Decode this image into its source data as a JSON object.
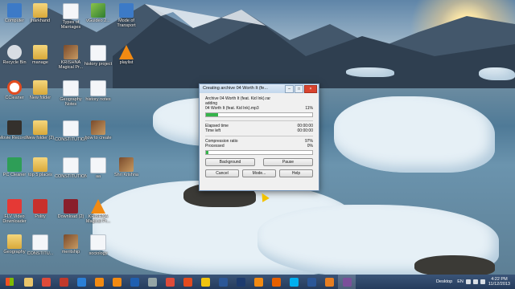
{
  "desktop": {
    "icons": [
      {
        "label": "Computer",
        "glyph": "computer-icon",
        "cls": "g-exe"
      },
      {
        "label": "jharkhand",
        "glyph": "folder-icon",
        "cls": "g-folder"
      },
      {
        "label": "Types of Marriages",
        "glyph": "document-icon",
        "cls": "g-doc"
      },
      {
        "label": "vGuideo 2...",
        "glyph": "video-icon",
        "cls": "g-arrow"
      },
      {
        "label": "Mode of Transport",
        "glyph": "presentation-icon",
        "cls": "g-exe"
      },
      {
        "label": "Recycle Bin",
        "glyph": "recycle-bin-icon",
        "cls": "g-gear"
      },
      {
        "label": "manage",
        "glyph": "folder-icon",
        "cls": "g-folder"
      },
      {
        "label": "KRISHNA Magical Pr...",
        "glyph": "image-icon",
        "cls": "g-img"
      },
      {
        "label": "history project",
        "glyph": "document-icon",
        "cls": "g-doc"
      },
      {
        "label": "playlist",
        "glyph": "vlc-icon",
        "cls": "g-vlc"
      },
      {
        "label": "CCleaner",
        "glyph": "ccleaner-icon",
        "cls": "g-cc"
      },
      {
        "label": "New folder",
        "glyph": "folder-icon",
        "cls": "g-folder"
      },
      {
        "label": "Geography Notes",
        "glyph": "document-icon",
        "cls": "g-doc"
      },
      {
        "label": "history notes",
        "glyph": "document-icon",
        "cls": "g-doc"
      },
      {
        "label": "Movie Recorder",
        "glyph": "movie-icon",
        "cls": "g-dark"
      },
      {
        "label": "New folder (2)",
        "glyph": "folder-icon",
        "cls": "g-folder"
      },
      {
        "label": "CONSTITUTION",
        "glyph": "document-icon",
        "cls": "g-doc"
      },
      {
        "label": "how to create",
        "glyph": "image-icon",
        "cls": "g-img"
      },
      {
        "label": "PC Cleaner",
        "glyph": "pc-cleaner-icon",
        "cls": "g-green"
      },
      {
        "label": "top 5 places",
        "glyph": "folder-icon",
        "cls": "g-folder"
      },
      {
        "label": "CONSTITUTION",
        "glyph": "document-icon",
        "cls": "g-doc"
      },
      {
        "label": "aa",
        "glyph": "document-icon",
        "cls": "g-doc"
      },
      {
        "label": "Shri Krishna",
        "glyph": "image-icon",
        "cls": "g-img"
      },
      {
        "label": "FLV Video Downloader",
        "glyph": "downloader-icon",
        "cls": "g-red"
      },
      {
        "label": "Polity",
        "glyph": "pdf-icon",
        "cls": "g-pdf"
      },
      {
        "label": "Download (2)",
        "glyph": "archive-icon",
        "cls": "g-maroon"
      },
      {
        "label": "KRISHNA Magical Pr...",
        "glyph": "vlc-icon",
        "cls": "g-vlc"
      },
      {
        "label": "Geography",
        "glyph": "folder-icon",
        "cls": "g-folder"
      },
      {
        "label": "CONSTITU...",
        "glyph": "document-icon",
        "cls": "g-doc"
      },
      {
        "label": "meritship",
        "glyph": "image-icon",
        "cls": "g-img"
      },
      {
        "label": "sociology",
        "glyph": "document-icon",
        "cls": "g-doc"
      }
    ]
  },
  "dialog": {
    "title": "Creating archive 04 Worth It (fe...",
    "archive_line": "Archive 04 Worth It (feat. Kid Ink).rar",
    "action": "adding",
    "file": "04 Worth It (feat. Kid Ink).mp3",
    "file_progress_text": "11%",
    "file_progress": 0.11,
    "elapsed_label": "Elapsed time",
    "elapsed_value": "00:00:00",
    "left_label": "Time left",
    "left_value": "00:00:00",
    "ratio_label": "Compression ratio",
    "ratio_value": "97%",
    "processed_label": "Processed",
    "processed_value": "0%",
    "overall_progress": 0.02,
    "buttons": {
      "background": "Background",
      "pause": "Pause",
      "cancel": "Cancel",
      "mode": "Mode...",
      "help": "Help"
    }
  },
  "taskbar": {
    "apps": [
      {
        "name": "explorer-icon",
        "color": "#e9c46a"
      },
      {
        "name": "chrome-icon",
        "color": "#de4b3a"
      },
      {
        "name": "phone-icon",
        "color": "#c0392b"
      },
      {
        "name": "media-player-icon",
        "color": "#2b7fd6"
      },
      {
        "name": "vlc-icon",
        "color": "#f28a12"
      },
      {
        "name": "vlc-icon",
        "color": "#f28a12"
      },
      {
        "name": "windows-media-icon",
        "color": "#1f5fb0"
      },
      {
        "name": "library-icon",
        "color": "#95a5a6"
      },
      {
        "name": "chrome-icon",
        "color": "#de4b3a"
      },
      {
        "name": "ccleaner-icon",
        "color": "#e34b1f"
      },
      {
        "name": "pencil-icon",
        "color": "#f1c40f"
      },
      {
        "name": "word-icon",
        "color": "#2b5797"
      },
      {
        "name": "photoshop-icon",
        "color": "#1d3b6e"
      },
      {
        "name": "vlc-icon",
        "color": "#f28a12"
      },
      {
        "name": "firefox-icon",
        "color": "#e66000"
      },
      {
        "name": "skype-icon",
        "color": "#00aff0"
      },
      {
        "name": "word-icon",
        "color": "#2b5797"
      },
      {
        "name": "unknown-icon",
        "color": "#e67e22"
      },
      {
        "name": "winrar-icon",
        "color": "#7b4f9a"
      }
    ],
    "desktop_label": "Desktop",
    "lang": "EN",
    "time": "4:22 PM",
    "date": "11/12/2013"
  }
}
